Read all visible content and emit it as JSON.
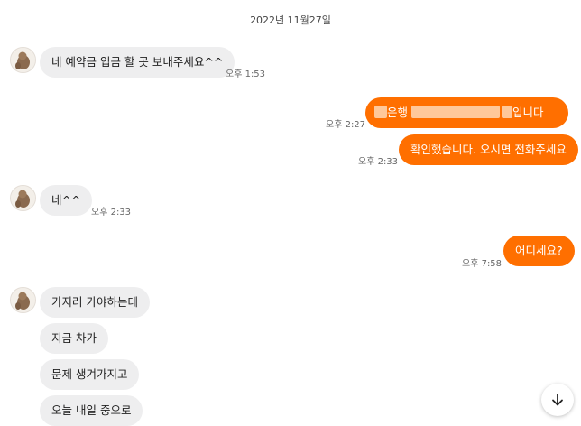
{
  "chat": {
    "date": "2022년 11월27일",
    "messages": [
      {
        "sender": "other",
        "text": "네 예약금 입금 할 곳 보내주세요^^",
        "time": "오후 1:53"
      },
      {
        "sender": "me",
        "text_suffix": "입니다",
        "text_bank": "은행",
        "redacted": true,
        "time": "오후 2:27"
      },
      {
        "sender": "me",
        "text": "확인했습니다. 오시면 전화주세요",
        "time": "오후 2:33"
      },
      {
        "sender": "other",
        "text": "네^^",
        "time": "오후 2:33"
      },
      {
        "sender": "me",
        "text": "어디세요?",
        "time": "오후 7:58"
      },
      {
        "sender": "other",
        "text": "가지러 가야하는데"
      },
      {
        "sender": "other",
        "text": "지금 차가"
      },
      {
        "sender": "other",
        "text": "문제 생겨가지고"
      },
      {
        "sender": "other",
        "text": "오늘 내일 중으로"
      }
    ]
  },
  "icons": {
    "avatar": "avatar-icon",
    "scroll_down": "arrow-down-icon"
  },
  "colors": {
    "outgoing_bubble": "#ff6f00",
    "incoming_bubble": "#eeeeef"
  }
}
